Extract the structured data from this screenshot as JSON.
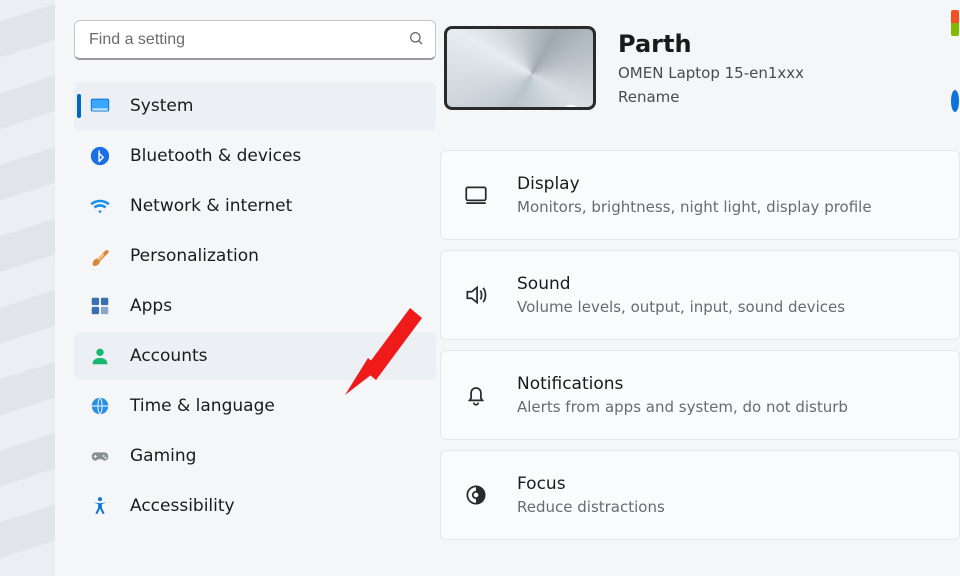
{
  "search": {
    "placeholder": "Find a setting"
  },
  "nav": [
    {
      "label": "System"
    },
    {
      "label": "Bluetooth & devices"
    },
    {
      "label": "Network & internet"
    },
    {
      "label": "Personalization"
    },
    {
      "label": "Apps"
    },
    {
      "label": "Accounts"
    },
    {
      "label": "Time & language"
    },
    {
      "label": "Gaming"
    },
    {
      "label": "Accessibility"
    }
  ],
  "pc": {
    "name": "Parth",
    "model": "OMEN Laptop 15-en1xxx",
    "rename": "Rename"
  },
  "cards": [
    {
      "title": "Display",
      "sub": "Monitors, brightness, night light, display profile"
    },
    {
      "title": "Sound",
      "sub": "Volume levels, output, input, sound devices"
    },
    {
      "title": "Notifications",
      "sub": "Alerts from apps and system, do not disturb"
    },
    {
      "title": "Focus",
      "sub": "Reduce distractions"
    }
  ]
}
